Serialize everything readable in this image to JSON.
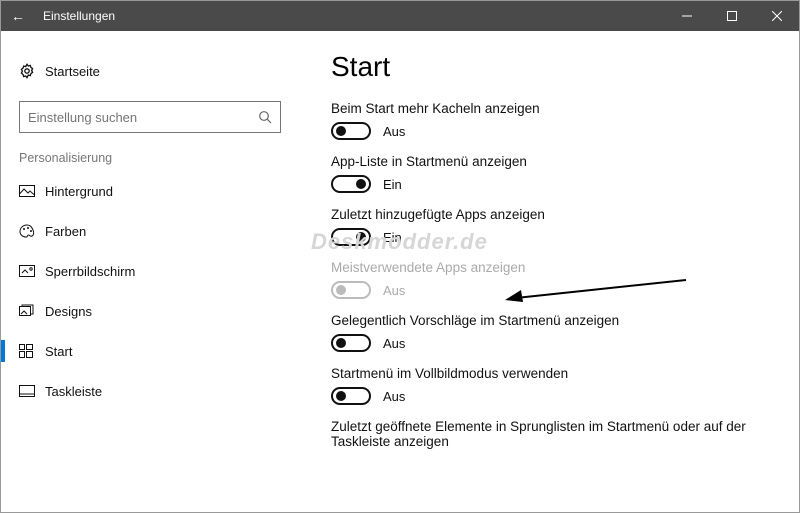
{
  "titlebar": {
    "title": "Einstellungen"
  },
  "sidebar": {
    "home": "Startseite",
    "search_placeholder": "Einstellung suchen",
    "group": "Personalisierung",
    "items": [
      {
        "label": "Hintergrund"
      },
      {
        "label": "Farben"
      },
      {
        "label": "Sperrbildschirm"
      },
      {
        "label": "Designs"
      },
      {
        "label": "Start"
      },
      {
        "label": "Taskleiste"
      }
    ]
  },
  "main": {
    "heading": "Start",
    "options": [
      {
        "label": "Beim Start mehr Kacheln anzeigen",
        "value": false,
        "text": "Aus",
        "disabled": false
      },
      {
        "label": "App-Liste in Startmenü anzeigen",
        "value": true,
        "text": "Ein",
        "disabled": false
      },
      {
        "label": "Zuletzt hinzugefügte Apps anzeigen",
        "value": true,
        "text": "Ein",
        "disabled": false
      },
      {
        "label": "Meistverwendete Apps anzeigen",
        "value": false,
        "text": "Aus",
        "disabled": true
      },
      {
        "label": "Gelegentlich Vorschläge im Startmenü anzeigen",
        "value": false,
        "text": "Aus",
        "disabled": false
      },
      {
        "label": "Startmenü im Vollbildmodus verwenden",
        "value": false,
        "text": "Aus",
        "disabled": false
      },
      {
        "label": "Zuletzt geöffnete Elemente in Sprunglisten im Startmenü oder auf der Taskleiste anzeigen",
        "value": null,
        "text": "",
        "disabled": false
      }
    ]
  },
  "watermark": "Deskmodder.de"
}
